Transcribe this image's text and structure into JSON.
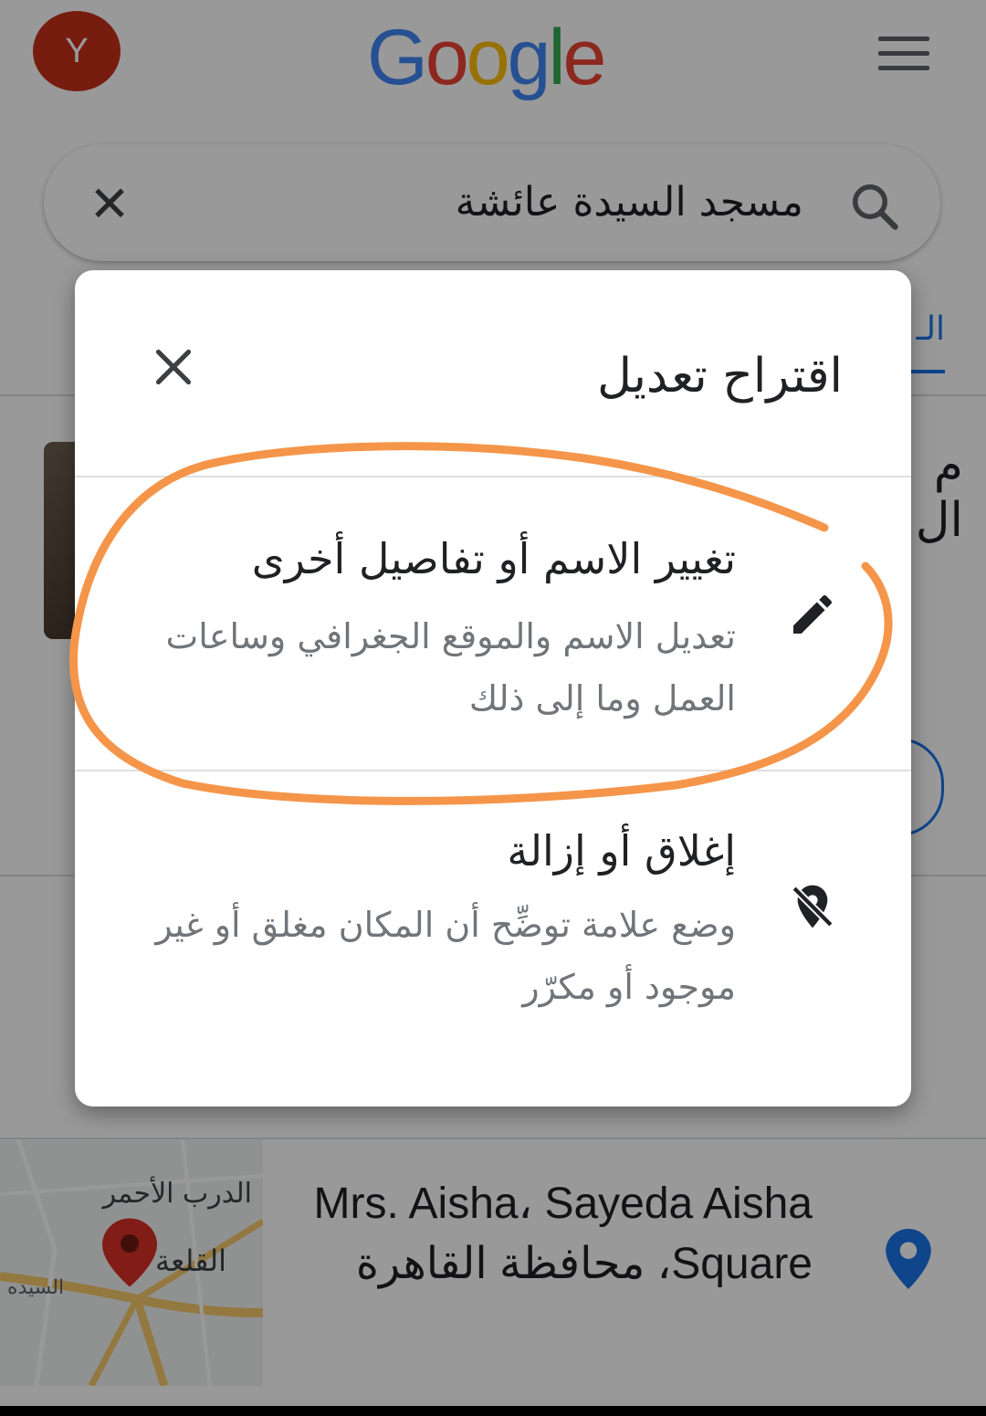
{
  "header": {
    "avatar_letter": "Y",
    "logo_text": "Google",
    "logo_colors": [
      "#4285F4",
      "#EA4335",
      "#FBBC05",
      "#4285F4",
      "#34A853",
      "#EA4335"
    ]
  },
  "search": {
    "query": "مسجد السيدة عائشة"
  },
  "background": {
    "tab_fragment": "الـ",
    "title_fragment": "م ال"
  },
  "map": {
    "label_1": "الدرب الأحمر",
    "label_2": "القلعة",
    "label_3": "السيده"
  },
  "address": {
    "text": "Mrs. Aisha، Sayeda Aisha Square، محافظة القاهرة"
  },
  "dialog": {
    "title": "اقتراح تعديل",
    "options": [
      {
        "title": "تغيير الاسم أو تفاصيل أخرى",
        "description": "تعديل الاسم والموقع الجغرافي وساعات العمل وما إلى ذلك",
        "icon": "pencil-icon"
      },
      {
        "title": "إغلاق أو إزالة",
        "description": "وضع علامة توضِّح أن المكان مغلق أو غير موجود أو مكرّر",
        "icon": "location-off-icon"
      }
    ]
  },
  "colors": {
    "annotation": "#f5954a",
    "pin_blue": "#1a73e8",
    "avatar": "#c5311c"
  }
}
